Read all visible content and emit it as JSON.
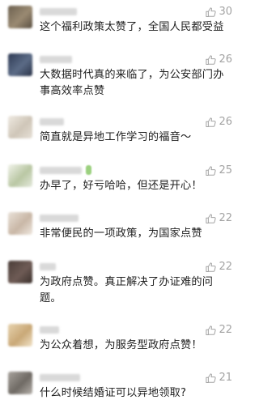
{
  "comments": [
    {
      "text": "这个福利政策太赞了，全国人民都受益",
      "likes": "30"
    },
    {
      "text": "大数据时代真的来临了，为公安部门办事高效率点赞",
      "likes": "26"
    },
    {
      "text": "简直就是异地工作学习的福音～",
      "likes": "26"
    },
    {
      "text": "办早了，好亏哈哈，但还是开心！",
      "likes": "25"
    },
    {
      "text": "非常便民的一项政策，为国家点赞",
      "likes": "22"
    },
    {
      "text": "为政府点赞。真正解决了办证难的问题。",
      "likes": "22"
    },
    {
      "text": "为公众着想，为服务型政府点赞！",
      "likes": "22"
    },
    {
      "text": "什么时候结婚证可以异地领取?",
      "likes": "21"
    }
  ],
  "colors": {
    "text": "#1f1f1f",
    "like": "#a3a3a3",
    "avatar_palette": [
      "#7d7160",
      "#3e4d66",
      "#d8d2c8",
      "#b9c7a3",
      "#c9b7a6",
      "#5a4a45",
      "#c9a877",
      "#8a8580"
    ]
  },
  "icons": {
    "like": "thumb-up-icon"
  }
}
